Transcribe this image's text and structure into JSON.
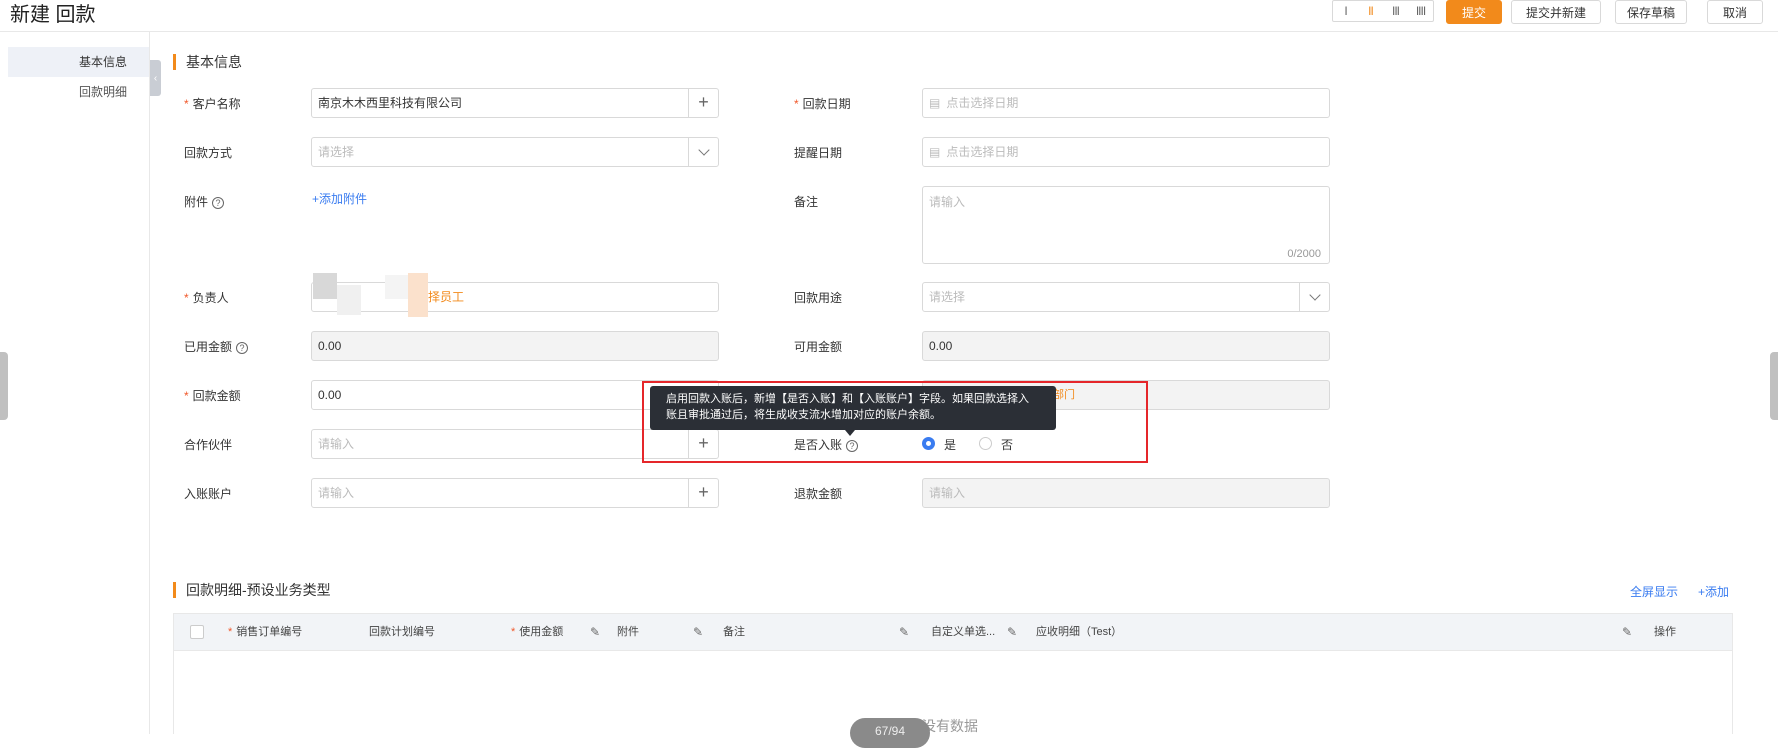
{
  "header": {
    "title": "新建 回款",
    "col_switch": [
      "I",
      "II",
      "III",
      "IIII"
    ],
    "buttons": {
      "submit": "提交",
      "submit_new": "提交并新建",
      "save_draft": "保存草稿",
      "cancel": "取消"
    }
  },
  "sidenav": {
    "items": [
      "基本信息",
      "回款明细"
    ],
    "active": "基本信息"
  },
  "basic": {
    "section_title": "基本信息",
    "customer": {
      "label": "客户名称",
      "value": "南京木木西里科技有限公司"
    },
    "pay_date": {
      "label": "回款日期",
      "placeholder": "点击选择日期"
    },
    "pay_method": {
      "label": "回款方式",
      "placeholder": "请选择"
    },
    "remind_date": {
      "label": "提醒日期",
      "placeholder": "点击选择日期"
    },
    "attachment": {
      "label": "附件",
      "link": "+添加附件"
    },
    "remark": {
      "label": "备注",
      "placeholder": "请输入",
      "counter": "0/2000"
    },
    "owner": {
      "label": "负责人",
      "value": "择员工"
    },
    "purpose": {
      "label": "回款用途",
      "placeholder": "请选择"
    },
    "used_amount": {
      "label": "已用金额",
      "value": "0.00"
    },
    "available_amount": {
      "label": "可用金额",
      "value": "0.00"
    },
    "pay_amount": {
      "label": "回款金额",
      "value": "0.00"
    },
    "dept_fragment": "部门",
    "partner": {
      "label": "合作伙伴",
      "placeholder": "请输入"
    },
    "is_booked": {
      "label": "是否入账",
      "yes": "是",
      "no": "否",
      "selected": "是"
    },
    "account": {
      "label": "入账账户",
      "placeholder": "请输入"
    },
    "refund_amount": {
      "label": "退款金额",
      "placeholder": "请输入"
    }
  },
  "tooltip": {
    "line1": "启用回款入账后，新增【是否入账】和【入账账户】字段。如果回款选择入",
    "line2": "账且审批通过后，将生成收支流水增加对应的账户余额。"
  },
  "detail": {
    "section_title": "回款明细-预设业务类型",
    "fullscreen": "全屏显示",
    "add": "+添加",
    "columns": [
      "销售订单编号",
      "回款计划编号",
      "使用金额",
      "附件",
      "备注",
      "自定义单选...",
      "应收明细（Test）",
      "操作"
    ],
    "empty": "没有数据",
    "pager": "67/94"
  },
  "icons": [
    "chevron-left-icon",
    "plus-icon",
    "calendar-icon",
    "chevron-down-icon",
    "help-icon",
    "edit-icon"
  ]
}
